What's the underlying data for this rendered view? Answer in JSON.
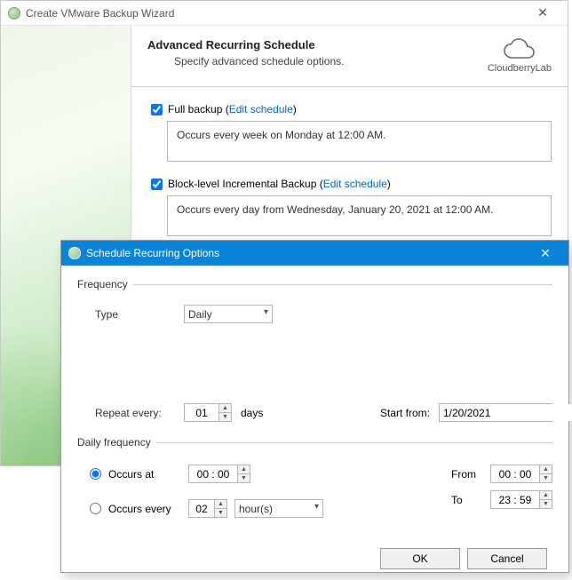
{
  "wizard": {
    "title": "Create VMware Backup Wizard",
    "heading": "Advanced Recurring Schedule",
    "subheading": "Specify advanced schedule options.",
    "brand": "CloudberryLab"
  },
  "full_backup": {
    "label_prefix": "Full backup (",
    "link": "Edit schedule",
    "label_suffix": ")",
    "desc": "Occurs every week on Monday at 12:00 AM."
  },
  "incr_backup": {
    "label_prefix": "Block-level Incremental Backup (",
    "link": "Edit schedule",
    "label_suffix": ")",
    "desc": "Occurs every day from Wednesday, January 20, 2021 at 12:00 AM."
  },
  "dialog": {
    "title": "Schedule Recurring Options",
    "frequency_legend": "Frequency",
    "type_label": "Type",
    "type_value": "Daily",
    "repeat_label": "Repeat every:",
    "repeat_value": "01",
    "repeat_unit": "days",
    "start_label": "Start from:",
    "start_value": "1/20/2021",
    "daily_legend": "Daily frequency",
    "occurs_at_label": "Occurs at",
    "occurs_at_value": "00 : 00",
    "occurs_every_label": "Occurs every",
    "occurs_every_value": "02",
    "occurs_every_unit": "hour(s)",
    "from_label": "From",
    "from_value": "00 : 00",
    "to_label": "To",
    "to_value": "23 : 59",
    "ok": "OK",
    "cancel": "Cancel"
  }
}
